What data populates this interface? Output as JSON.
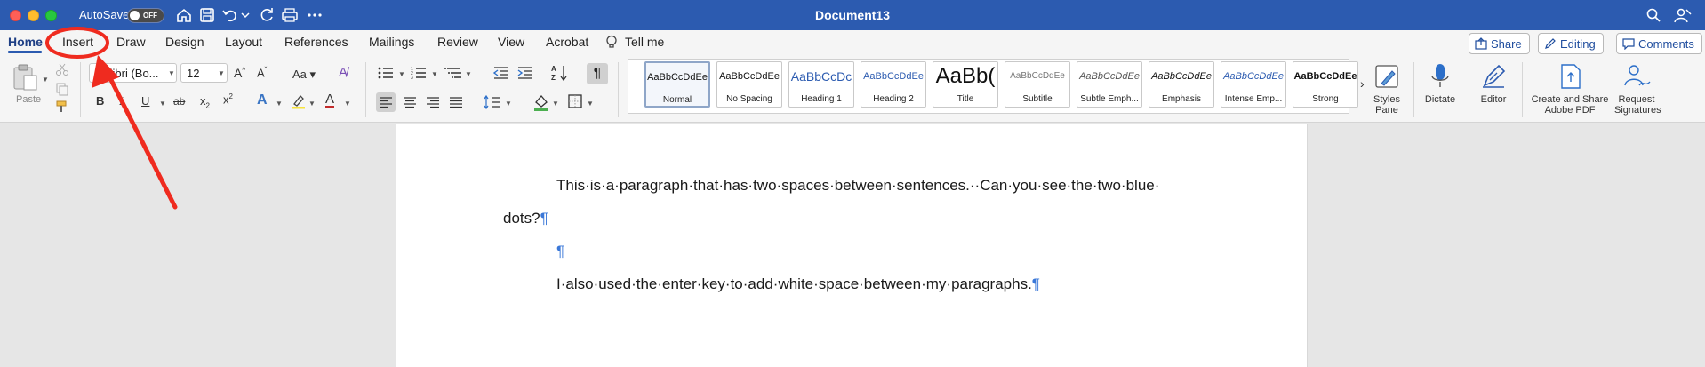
{
  "window": {
    "autosave_label": "AutoSave",
    "autosave_state": "OFF",
    "document_title": "Document13"
  },
  "tabs": [
    "Home",
    "Insert",
    "Draw",
    "Design",
    "Layout",
    "References",
    "Mailings",
    "Review",
    "View",
    "Acrobat"
  ],
  "active_tab": "Home",
  "tell_me": "Tell me",
  "actions": {
    "share": "Share",
    "editing": "Editing",
    "comments": "Comments"
  },
  "ribbon": {
    "paste_label": "Paste",
    "font_name": "Calibri (Bo...",
    "font_size": "12",
    "change_case": "Aa",
    "styles": [
      {
        "preview": "AaBbCcDdEe",
        "name": "Normal"
      },
      {
        "preview": "AaBbCcDdEe",
        "name": "No Spacing"
      },
      {
        "preview": "AaBbCcDc",
        "name": "Heading 1"
      },
      {
        "preview": "AaBbCcDdEe",
        "name": "Heading 2"
      },
      {
        "preview": "AaBb(",
        "name": "Title"
      },
      {
        "preview": "AaBbCcDdEe",
        "name": "Subtitle"
      },
      {
        "preview": "AaBbCcDdEe",
        "name": "Subtle Emph..."
      },
      {
        "preview": "AaBbCcDdEe",
        "name": "Emphasis"
      },
      {
        "preview": "AaBbCcDdEe",
        "name": "Intense Emp..."
      },
      {
        "preview": "AaBbCcDdEe",
        "name": "Strong"
      }
    ],
    "styles_pane": [
      "Styles",
      "Pane"
    ],
    "dictate": "Dictate",
    "editor": "Editor",
    "create_share_pdf": [
      "Create and Share",
      "Adobe PDF"
    ],
    "request_signatures": [
      "Request",
      "Signatures"
    ]
  },
  "document": {
    "line1": "This·is·a·paragraph·that·has·two·spaces·between·sentences.··Can·you·see·the·two·blue·",
    "line2": "dots?",
    "line4": "I·also·used·the·enter·key·to·add·white·space·between·my·paragraphs.",
    "pilcrow": "¶"
  },
  "colors": {
    "titlebar": "#2c5bb0",
    "accent": "#1f4d9e",
    "annotation": "#ef2b1f",
    "formatting_marks": "#3b78d8"
  }
}
